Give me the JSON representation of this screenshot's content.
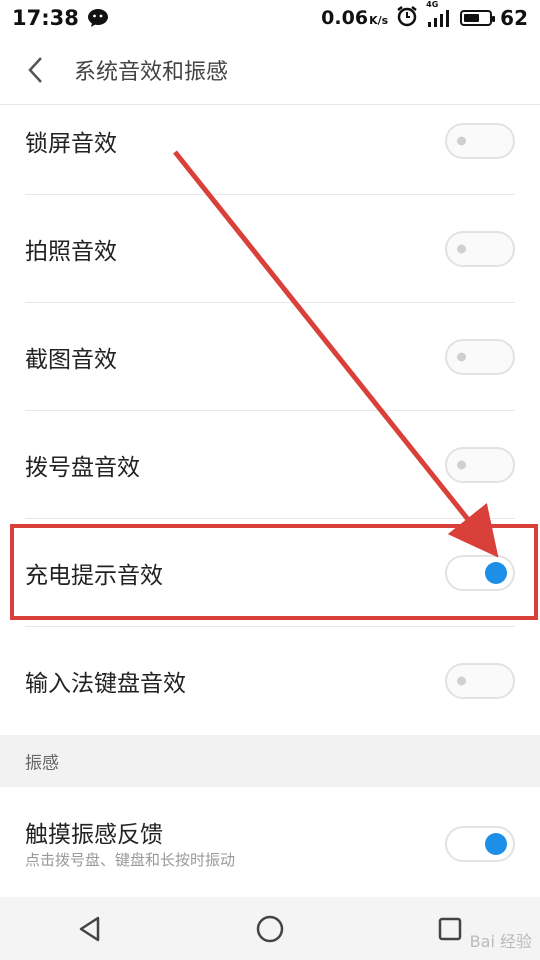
{
  "status_bar": {
    "time": "17:38",
    "net_speed": "0.06",
    "net_unit": "K/s",
    "signal_label": "4G",
    "battery_level": "62",
    "battery_fraction": 0.62
  },
  "header": {
    "title": "系统音效和振感"
  },
  "settings": [
    {
      "label": "锁屏音效",
      "on": false
    },
    {
      "label": "拍照音效",
      "on": false
    },
    {
      "label": "截图音效",
      "on": false
    },
    {
      "label": "拨号盘音效",
      "on": false
    },
    {
      "label": "充电提示音效",
      "on": true
    },
    {
      "label": "输入法键盘音效",
      "on": false
    }
  ],
  "haptics_section": {
    "header": "振感",
    "item_label": "触摸振感反馈",
    "item_sub": "点击拨号盘、键盘和长按时振动",
    "item_on": true
  },
  "watermark": {
    "text": "Bai 经验"
  },
  "colors": {
    "accent": "#1e8fe6",
    "annotation": "#d9403a"
  },
  "icons": {
    "back": "chevron-left-icon",
    "wechat": "wechat-icon",
    "alarm": "alarm-icon",
    "signal": "signal-icon",
    "battery": "battery-icon",
    "nav_back": "triangle-back-icon",
    "nav_home": "circle-home-icon",
    "nav_recent": "square-recent-icon"
  }
}
